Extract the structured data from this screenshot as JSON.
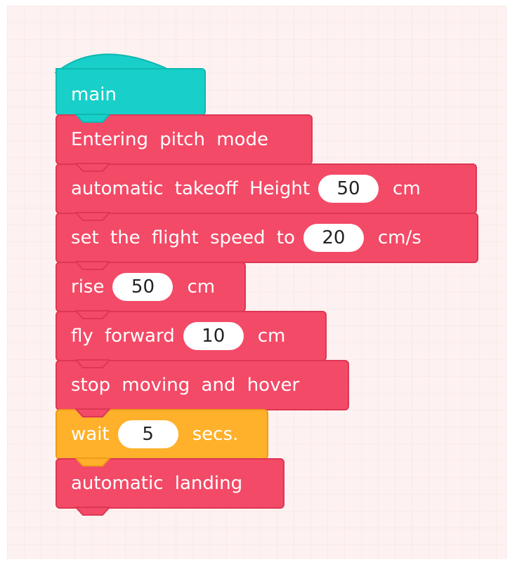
{
  "blocks": {
    "main": {
      "label": "main"
    },
    "pitch_mode": {
      "label": "Entering pitch mode"
    },
    "takeoff": {
      "label": "automatic takeoff Height",
      "value": "50",
      "unit": "cm"
    },
    "speed": {
      "label": "set the flight speed to",
      "value": "20",
      "unit": "cm/s"
    },
    "rise": {
      "label": "rise",
      "value": "50",
      "unit": "cm"
    },
    "forward": {
      "label": "fly forward",
      "value": "10",
      "unit": "cm"
    },
    "hover": {
      "label": "stop moving and hover"
    },
    "wait": {
      "label": "wait",
      "value": "5",
      "unit": "secs."
    },
    "landing": {
      "label": "automatic landing"
    }
  },
  "colors": {
    "event": "#18cfc9",
    "drone": "#f34a67",
    "control": "#ffb12b",
    "workspace": "#fdf2f1"
  }
}
